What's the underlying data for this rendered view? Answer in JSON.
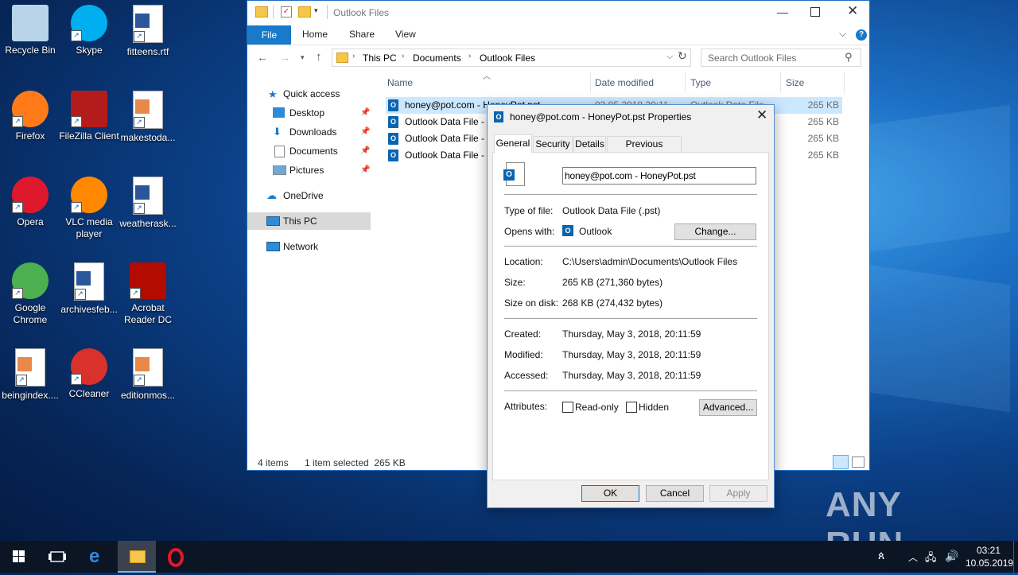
{
  "desktop": {
    "icons": [
      {
        "label": "Recycle Bin",
        "icon": "recycle-bin-icon"
      },
      {
        "label": "Skype",
        "icon": "skype-icon"
      },
      {
        "label": "fitteens.rtf",
        "icon": "word-doc-icon"
      },
      {
        "label": "Firefox",
        "icon": "firefox-icon"
      },
      {
        "label": "FileZilla Client",
        "icon": "filezilla-icon"
      },
      {
        "label": "makestoda...",
        "icon": "image-file-icon"
      },
      {
        "label": "Opera",
        "icon": "opera-icon"
      },
      {
        "label": "VLC media player",
        "icon": "vlc-icon"
      },
      {
        "label": "weatherask...",
        "icon": "word-doc-icon"
      },
      {
        "label": "Google Chrome",
        "icon": "chrome-icon"
      },
      {
        "label": "archivesfeb...",
        "icon": "word-doc-icon"
      },
      {
        "label": "Acrobat Reader DC",
        "icon": "acrobat-icon"
      },
      {
        "label": "beingindex....",
        "icon": "image-file-icon"
      },
      {
        "label": "CCleaner",
        "icon": "ccleaner-icon"
      },
      {
        "label": "editionmos...",
        "icon": "image-file-icon"
      }
    ],
    "watermark": "ANY RUN"
  },
  "explorer": {
    "title": "Outlook Files",
    "ribbon_tabs": [
      "File",
      "Home",
      "Share",
      "View"
    ],
    "breadcrumb": [
      "This PC",
      "Documents",
      "Outlook Files"
    ],
    "search_placeholder": "Search Outlook Files",
    "nav": [
      {
        "label": "Quick access"
      },
      {
        "label": "Desktop"
      },
      {
        "label": "Downloads"
      },
      {
        "label": "Documents"
      },
      {
        "label": "Pictures"
      },
      {
        "label": "OneDrive"
      },
      {
        "label": "This PC"
      },
      {
        "label": "Network"
      }
    ],
    "columns": [
      "Name",
      "Date modified",
      "Type",
      "Size"
    ],
    "files": [
      {
        "name": "honey@pot.com - HoneyPot.pst",
        "date": "03.05.2018 20:11",
        "type": "Outlook Data File",
        "size": "265 KB"
      },
      {
        "name": "Outlook Data File - ",
        "size": "265 KB"
      },
      {
        "name": "Outlook Data File - ",
        "size": "265 KB"
      },
      {
        "name": "Outlook Data File - ",
        "size": "265 KB"
      }
    ],
    "status_items": "4 items",
    "status_selected": "1 item selected  265 KB"
  },
  "dialog": {
    "title": "honey@pot.com - HoneyPot.pst Properties",
    "tabs": [
      "General",
      "Security",
      "Details",
      "Previous Versions"
    ],
    "filename": "honey@pot.com - HoneyPot.pst",
    "type_label": "Type of file:",
    "type_value": "Outlook Data File (.pst)",
    "opens_label": "Opens with:",
    "opens_value": "Outlook",
    "change_button": "Change...",
    "location_label": "Location:",
    "location_value": "C:\\Users\\admin\\Documents\\Outlook Files",
    "size_label": "Size:",
    "size_value": "265 KB (271,360 bytes)",
    "sizeondisk_label": "Size on disk:",
    "sizeondisk_value": "268 KB (274,432 bytes)",
    "created_label": "Created:",
    "created_value": "Thursday, May 3, 2018, 20:11:59",
    "modified_label": "Modified:",
    "modified_value": "Thursday, May 3, 2018, 20:11:59",
    "accessed_label": "Accessed:",
    "accessed_value": "Thursday, May 3, 2018, 20:11:59",
    "attributes_label": "Attributes:",
    "readonly_label": "Read-only",
    "hidden_label": "Hidden",
    "advanced_button": "Advanced...",
    "ok_button": "OK",
    "cancel_button": "Cancel",
    "apply_button": "Apply"
  },
  "taskbar": {
    "time": "03:21",
    "date": "10.05.2019"
  },
  "colors": {
    "accent": "#1979ca",
    "taskbar": "#0c1523",
    "selection": "#cce8ff"
  }
}
